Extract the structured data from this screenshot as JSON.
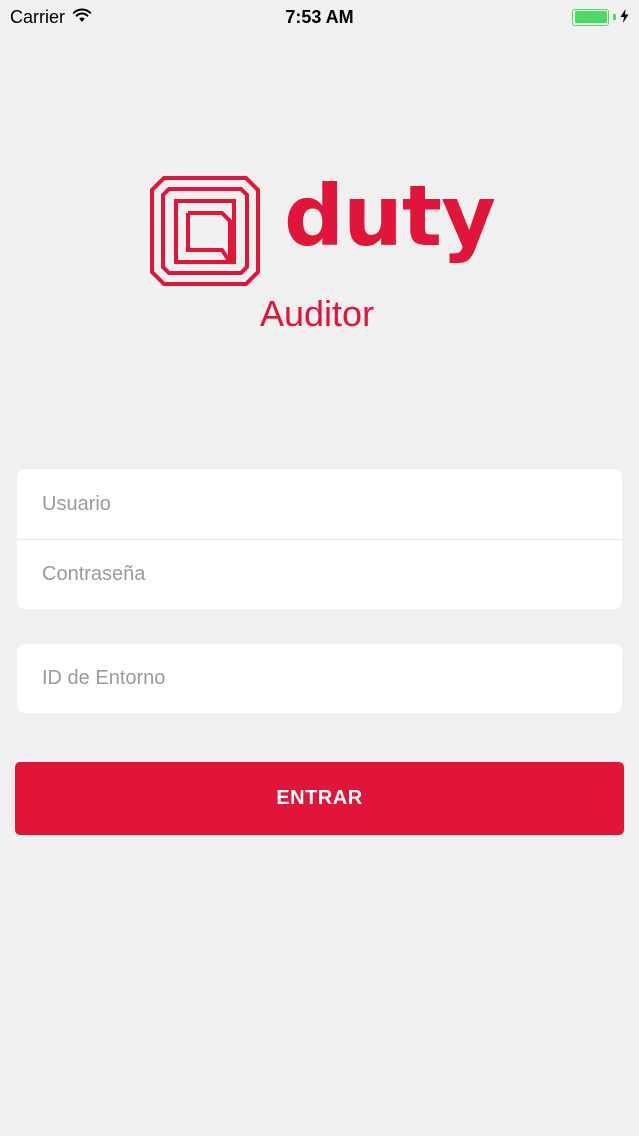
{
  "status_bar": {
    "carrier": "Carrier",
    "time": "7:53 AM",
    "wifi_icon": "wifi-icon",
    "battery_icon": "battery-icon",
    "charging_icon": "bolt-icon",
    "battery_level": 1.0,
    "battery_color": "#4cd964"
  },
  "logo": {
    "icon": "duty-logo-icon",
    "wordmark": "duty",
    "subtitle": "Auditor",
    "color": "#e1143a"
  },
  "form": {
    "username_placeholder": "Usuario",
    "password_placeholder": "Contraseña",
    "environment_placeholder": "ID de Entorno"
  },
  "submit": {
    "label": "ENTRAR",
    "color": "#e1143a"
  }
}
